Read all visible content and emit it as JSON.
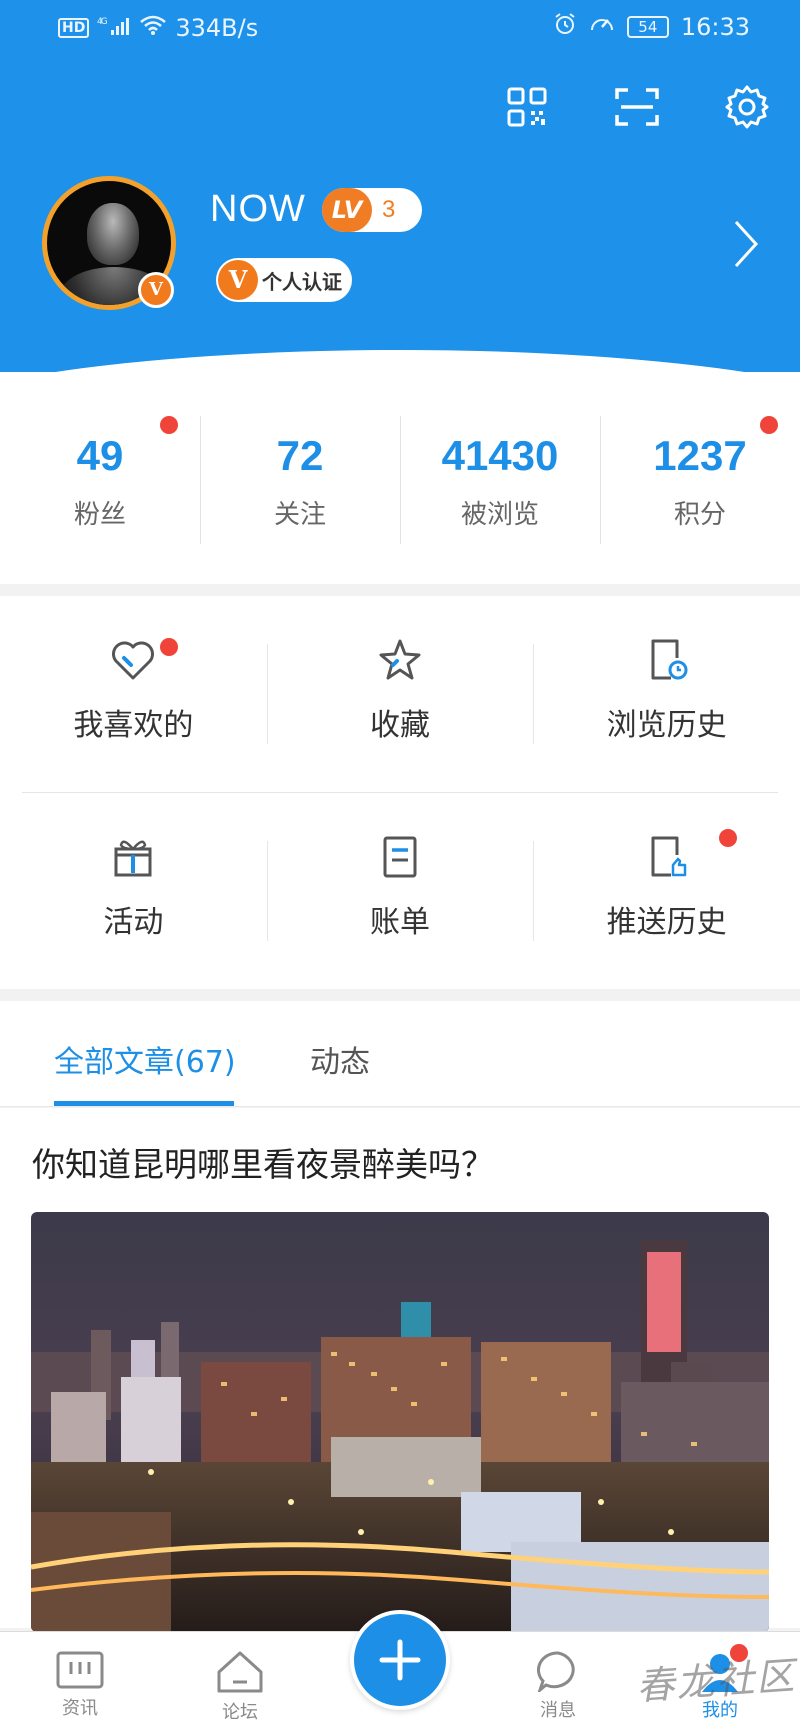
{
  "status_bar": {
    "hd": "HD",
    "network": "4G",
    "speed": "334B/s",
    "battery": "54",
    "time": "16:33"
  },
  "header": {
    "username": "NOW",
    "level_prefix": "LV",
    "level": "3",
    "cert_badge": "V",
    "cert_label": "个人认证",
    "avatar_badge": "V",
    "bg_color": "#1e91ea"
  },
  "stats": [
    {
      "value": "49",
      "label": "粉丝",
      "has_dot": true
    },
    {
      "value": "72",
      "label": "关注",
      "has_dot": false
    },
    {
      "value": "41430",
      "label": "被浏览",
      "has_dot": false
    },
    {
      "value": "1237",
      "label": "积分",
      "has_dot": true
    }
  ],
  "menu": [
    {
      "label": "我喜欢的",
      "icon": "heart-icon",
      "has_dot": true
    },
    {
      "label": "收藏",
      "icon": "star-icon",
      "has_dot": false
    },
    {
      "label": "浏览历史",
      "icon": "history-icon",
      "has_dot": false
    },
    {
      "label": "活动",
      "icon": "gift-icon",
      "has_dot": false
    },
    {
      "label": "账单",
      "icon": "bill-icon",
      "has_dot": false
    },
    {
      "label": "推送历史",
      "icon": "push-history-icon",
      "has_dot": true
    }
  ],
  "tabs": {
    "all_articles": "全部文章(67)",
    "activity": "动态"
  },
  "article": {
    "title": "你知道昆明哪里看夜景醉美吗？"
  },
  "bottom_nav": {
    "news": "资讯",
    "forum": "论坛",
    "messages": "消息",
    "mine": "我的"
  },
  "watermark": "春龙社区",
  "colors": {
    "accent": "#1d8fe6",
    "badge_orange": "#f07a1c",
    "notification_red": "#f0433a"
  }
}
